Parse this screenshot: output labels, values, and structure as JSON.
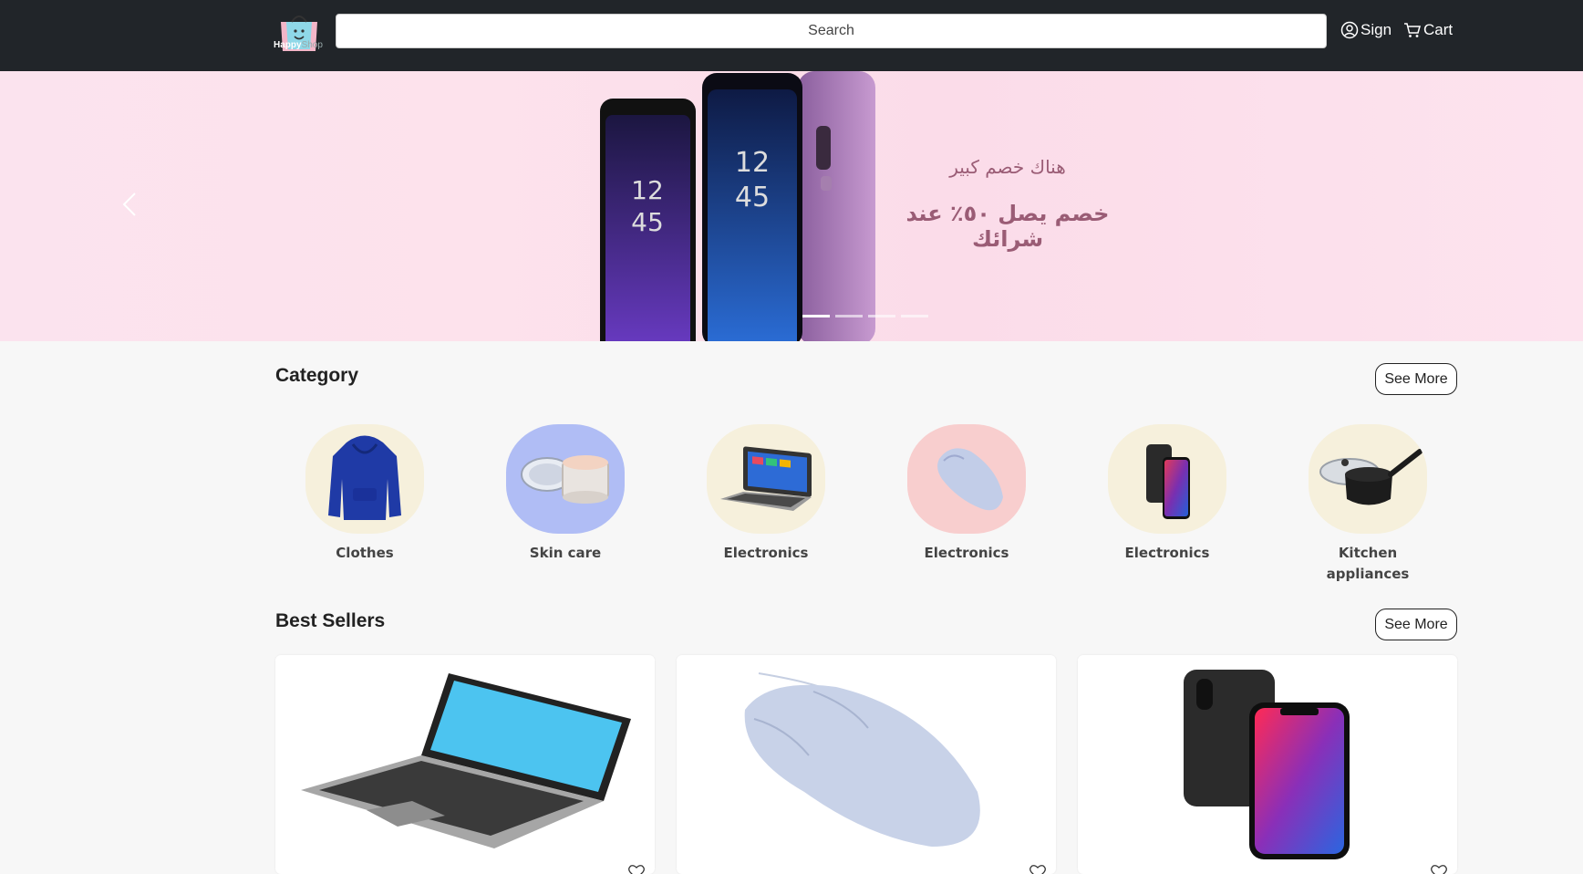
{
  "header": {
    "logo_text_primary": "Happy",
    "logo_text_secondary": "Shop",
    "search_placeholder": "Search",
    "sign_label": "Sign",
    "cart_label": "Cart"
  },
  "hero": {
    "line1": "هناك خصم كبير",
    "line2": "خصم يصل ٥٠٪ عند شرائك",
    "slide_count": 4,
    "active_slide": 1
  },
  "category": {
    "title": "Category",
    "see_more": "See More",
    "items": [
      {
        "label": "Clothes",
        "icon": "hoodie-icon",
        "bg": "#f6f0dc"
      },
      {
        "label": "Skin care",
        "icon": "cream-jar-icon",
        "bg": "#b0bdf5"
      },
      {
        "label": "Electronics",
        "icon": "laptop-icon",
        "bg": "#f6f0dc"
      },
      {
        "label": "Electronics",
        "icon": "mouse-icon",
        "bg": "#f8cece"
      },
      {
        "label": "Electronics",
        "icon": "phone-icon",
        "bg": "#f6f0dc"
      },
      {
        "label": "Kitchen appliances",
        "icon": "saucepan-icon",
        "bg": "#f6f0dc"
      }
    ]
  },
  "best_sellers": {
    "title": "Best Sellers",
    "see_more": "See More",
    "products": [
      {
        "icon": "laptop-icon"
      },
      {
        "icon": "mouse-icon"
      },
      {
        "icon": "phone-icon"
      }
    ]
  }
}
